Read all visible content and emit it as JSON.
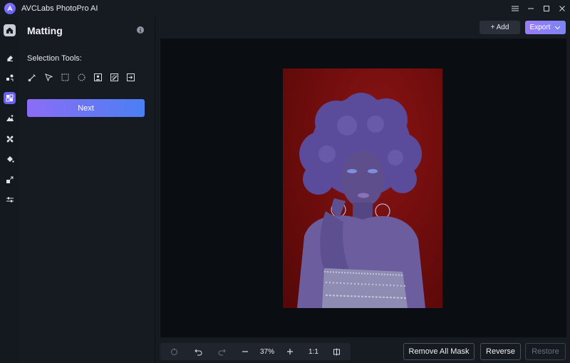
{
  "app": {
    "title": "AVCLabs PhotoPro AI"
  },
  "window_controls": [
    "menu-icon",
    "minimize-icon",
    "maximize-icon",
    "close-icon"
  ],
  "rail": {
    "items": [
      {
        "name": "home-icon",
        "active": false
      },
      {
        "name": "eraser-icon",
        "active": false
      },
      {
        "name": "object-replace-icon",
        "active": false
      },
      {
        "name": "matting-icon",
        "active": true
      },
      {
        "name": "enhance-icon",
        "active": false
      },
      {
        "name": "fan-icon",
        "active": false
      },
      {
        "name": "paint-bucket-icon",
        "active": false
      },
      {
        "name": "crop-expand-icon",
        "active": false
      },
      {
        "name": "adjust-sliders-icon",
        "active": false
      }
    ]
  },
  "panel": {
    "title": "Matting",
    "section_label": "Selection Tools:",
    "tools": [
      "brush-icon",
      "pointer-icon",
      "rect-select-icon",
      "ellipse-select-icon",
      "portrait-select-icon",
      "pattern-select-icon",
      "import-select-icon"
    ],
    "next_label": "Next"
  },
  "toolbar": {
    "add_label": "+ Add",
    "export_label": "Export"
  },
  "zoom": {
    "level": "37%",
    "one_to_one": "1:1"
  },
  "actions": {
    "remove_all_mask": "Remove All Mask",
    "reverse": "Reverse",
    "restore": "Restore"
  },
  "colors": {
    "accent": "#6a5ff5",
    "photo_background": "#7a0f0f",
    "canvas": "#0a0d12"
  }
}
